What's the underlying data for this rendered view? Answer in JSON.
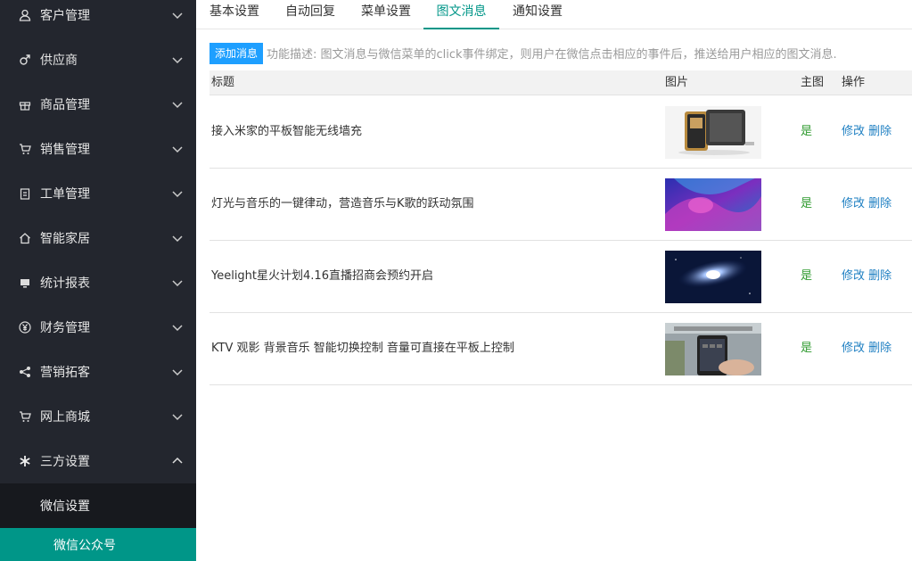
{
  "sidebar": {
    "items": [
      {
        "label": "客户管理",
        "icon": "user-icon"
      },
      {
        "label": "供应商",
        "icon": "male-icon"
      },
      {
        "label": "商品管理",
        "icon": "gift-icon"
      },
      {
        "label": "销售管理",
        "icon": "cart-icon"
      },
      {
        "label": "工单管理",
        "icon": "clipboard-icon"
      },
      {
        "label": "智能家居",
        "icon": "home-icon"
      },
      {
        "label": "统计报表",
        "icon": "monitor-icon"
      },
      {
        "label": "财务管理",
        "icon": "yen-icon"
      },
      {
        "label": "营销拓客",
        "icon": "share-icon"
      },
      {
        "label": "网上商城",
        "icon": "cart-icon"
      },
      {
        "label": "三方设置",
        "icon": "snowflake-icon"
      }
    ],
    "sub_items": [
      {
        "label": "微信设置"
      },
      {
        "label": "微信公众号"
      }
    ]
  },
  "tabs": [
    {
      "label": "基本设置"
    },
    {
      "label": "自动回复"
    },
    {
      "label": "菜单设置"
    },
    {
      "label": "图文消息"
    },
    {
      "label": "通知设置"
    }
  ],
  "toolbar": {
    "add_label": "添加消息",
    "description": "功能描述: 图文消息与微信菜单的click事件绑定，则用户在微信点击相应的事件后，推送给用户相应的图文消息."
  },
  "table": {
    "headers": {
      "title": "标题",
      "image": "图片",
      "main": "主图",
      "ops": "操作"
    },
    "rows": [
      {
        "title": "接入米家的平板智能无线墙充",
        "main": "是",
        "edit": "修改",
        "delete": "删除",
        "image": "wall-charger-product-photo"
      },
      {
        "title": "灯光与音乐的一键律动，营造音乐与K歌的跃动氛围",
        "main": "是",
        "edit": "修改",
        "delete": "删除",
        "image": "purple-abstract-photo"
      },
      {
        "title": "Yeelight星火计划4.16直播招商会预约开启",
        "main": "是",
        "edit": "修改",
        "delete": "删除",
        "image": "galaxy-photo"
      },
      {
        "title": "KTV 观影 背景音乐 智能切换控制 音量可直接在平板上控制",
        "main": "是",
        "edit": "修改",
        "delete": "删除",
        "image": "tablet-in-hand-photo"
      }
    ]
  },
  "colors": {
    "sidebar_bg": "#23262e",
    "accent": "#009688",
    "add_button": "#1e9fff",
    "link": "#1e7fc2",
    "yes": "#2f9a2f"
  }
}
